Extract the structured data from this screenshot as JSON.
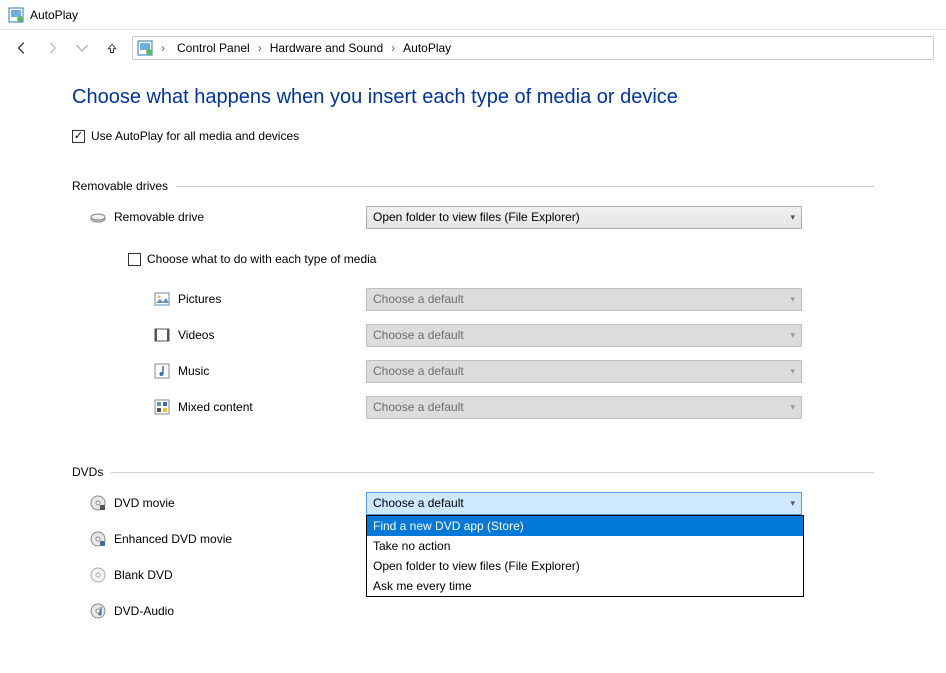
{
  "window": {
    "title": "AutoPlay"
  },
  "breadcrumb": {
    "items": [
      "Control Panel",
      "Hardware and Sound",
      "AutoPlay"
    ]
  },
  "page": {
    "title": "Choose what happens when you insert each type of media or device",
    "global_opt": "Use AutoPlay for all media and devices"
  },
  "sections": {
    "removable": {
      "title": "Removable drives",
      "drive_label": "Removable drive",
      "drive_value": "Open folder to view files (File Explorer)",
      "choose_each": "Choose what to do with each type of media",
      "pictures": "Pictures",
      "videos": "Videos",
      "music": "Music",
      "mixed": "Mixed content",
      "default_text": "Choose a default"
    },
    "dvds": {
      "title": "DVDs",
      "movie": "DVD movie",
      "enhanced": "Enhanced DVD movie",
      "blank": "Blank DVD",
      "audio": "DVD-Audio",
      "default_text": "Choose a default",
      "options": [
        "Find a new DVD app (Store)",
        "Take no action",
        "Open folder to view files (File Explorer)",
        "Ask me every time"
      ]
    }
  }
}
